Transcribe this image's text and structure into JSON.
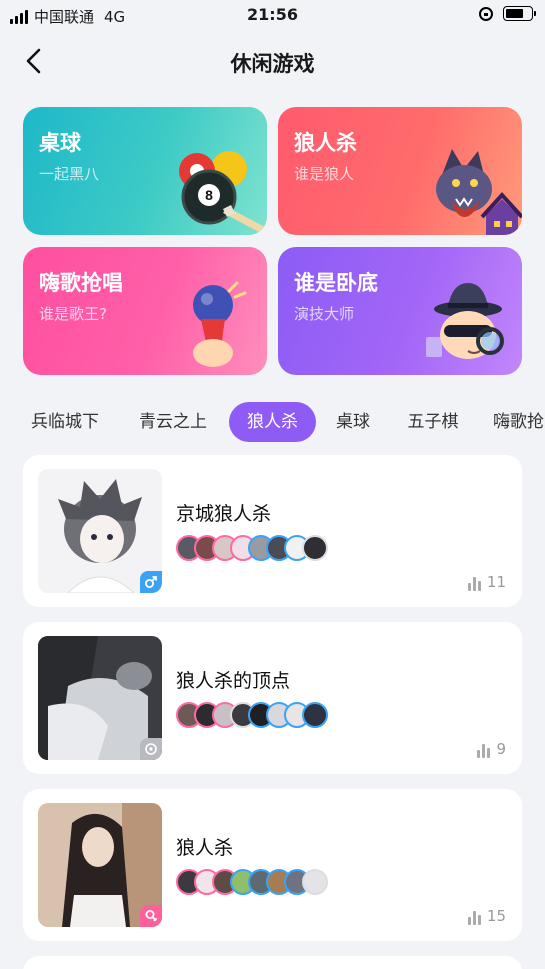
{
  "status": {
    "carrier": "中国联通",
    "network": "4G",
    "time": "21:56",
    "battery_level": 0.7
  },
  "nav": {
    "title": "休闲游戏"
  },
  "games": [
    {
      "title": "桌球",
      "subtitle": "一起黑八",
      "icon": "billiards-icon"
    },
    {
      "title": "狼人杀",
      "subtitle": "谁是狼人",
      "icon": "werewolf-icon"
    },
    {
      "title": "嗨歌抢唱",
      "subtitle": "谁是歌王?",
      "icon": "microphone-icon"
    },
    {
      "title": "谁是卧底",
      "subtitle": "演技大师",
      "icon": "spy-icon"
    }
  ],
  "tabs": [
    "兵临城下",
    "青云之上",
    "狼人杀",
    "桌球",
    "五子棋",
    "嗨歌抢"
  ],
  "active_tab": 2,
  "rooms": [
    {
      "title": "京城狼人杀",
      "count": "11",
      "badge": "male-icon",
      "badge_color": "#3aa3f5"
    },
    {
      "title": "狼人杀的顶点",
      "count": "9",
      "badge": "mode-icon",
      "badge_color": "#b9b9c2"
    },
    {
      "title": "狼人杀",
      "count": "15",
      "badge": "female-icon",
      "badge_color": "#ff5f9a"
    }
  ],
  "colors": {
    "accent": "#8e5cf4",
    "male": "#3aa3f5",
    "female": "#ff5f9a"
  }
}
